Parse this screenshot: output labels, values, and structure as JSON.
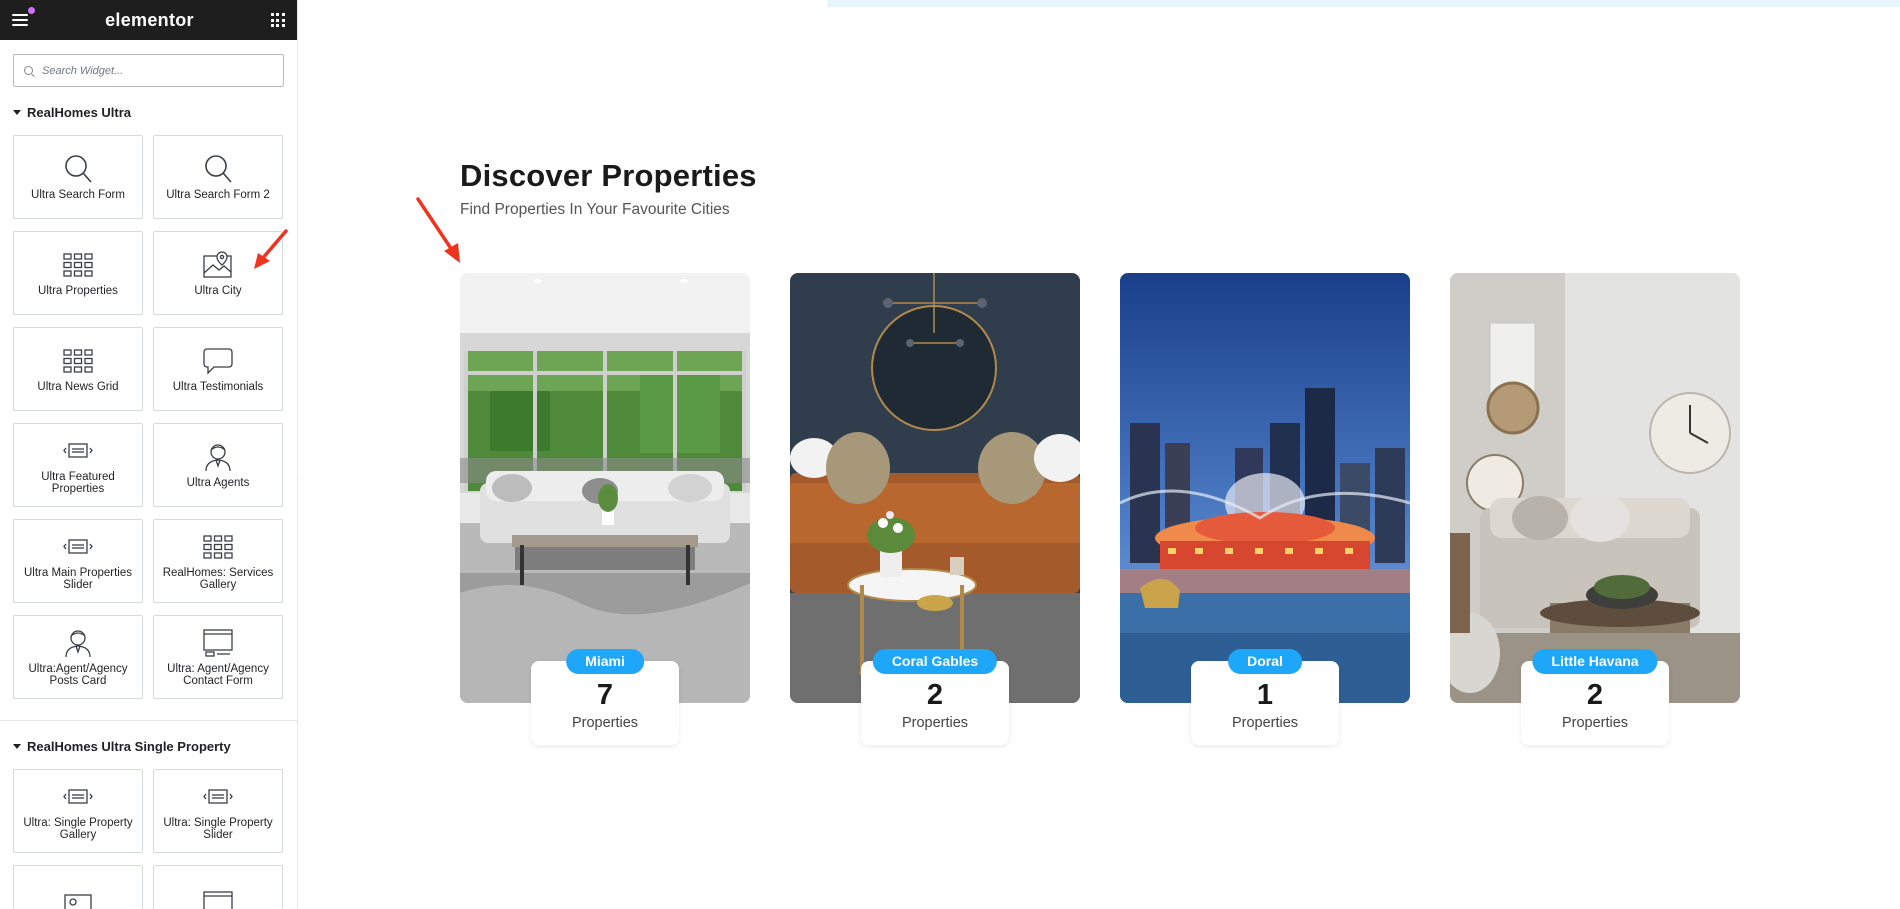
{
  "editor": {
    "logo": "elementor",
    "search_placeholder": "Search Widget...",
    "categories": [
      {
        "title": "RealHomes Ultra",
        "widgets": [
          {
            "label": "Ultra Search Form",
            "icon": "search-icon"
          },
          {
            "label": "Ultra Search Form 2",
            "icon": "search-icon"
          },
          {
            "label": "Ultra Properties",
            "icon": "grid-icon"
          },
          {
            "label": "Ultra City",
            "icon": "map-image-icon"
          },
          {
            "label": "Ultra News Grid",
            "icon": "grid-icon"
          },
          {
            "label": "Ultra Testimonials",
            "icon": "speech-bubble-icon"
          },
          {
            "label": "Ultra Featured Properties",
            "icon": "slider-icon"
          },
          {
            "label": "Ultra Agents",
            "icon": "agent-icon"
          },
          {
            "label": "Ultra Main Properties Slider",
            "icon": "slider-icon"
          },
          {
            "label": "RealHomes: Services Gallery",
            "icon": "grid-icon"
          },
          {
            "label": "Ultra:Agent/Agency Posts Card",
            "icon": "agent-icon"
          },
          {
            "label": "Ultra: Agent/Agency Contact Form",
            "icon": "form-icon"
          }
        ]
      },
      {
        "title": "RealHomes Ultra Single Property",
        "widgets": [
          {
            "label": "Ultra: Single Property Gallery",
            "icon": "slider-icon"
          },
          {
            "label": "Ultra: Single Property Slider",
            "icon": "slider-icon"
          },
          {
            "label": "",
            "icon": "gallery-icon"
          },
          {
            "label": "",
            "icon": "form-icon"
          }
        ]
      }
    ]
  },
  "page": {
    "title": "Discover Properties",
    "subtitle": "Find Properties In Your Favourite Cities",
    "cities": [
      {
        "name": "Miami",
        "count": "7",
        "label": "Properties"
      },
      {
        "name": "Coral Gables",
        "count": "2",
        "label": "Properties"
      },
      {
        "name": "Doral",
        "count": "1",
        "label": "Properties"
      },
      {
        "name": "Little Havana",
        "count": "2",
        "label": "Properties"
      }
    ]
  },
  "colors": {
    "accent_pill": "#1ea7f9",
    "annotation_arrow": "#f0331f",
    "header_bg": "#1e1e1e"
  }
}
